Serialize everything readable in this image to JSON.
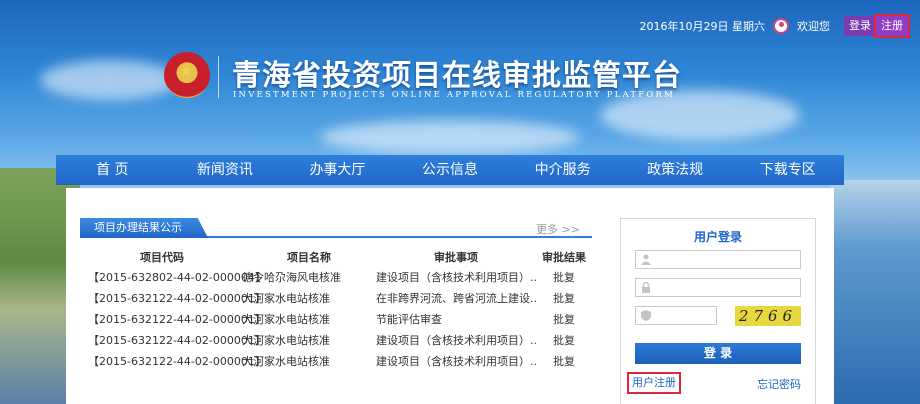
{
  "topbar": {
    "date": "2016年10月29日 星期六",
    "welcome": "欢迎您",
    "login_btn": "登录",
    "register_btn": "注册"
  },
  "header": {
    "title": "青海省投资项目在线审批监管平台",
    "subtitle": "INVESTMENT PROJECTS ONLINE APPROVAL REGULATORY PLATFORM"
  },
  "nav": {
    "items": [
      "首 页",
      "新闻资讯",
      "办事大厅",
      "公示信息",
      "中介服务",
      "政策法规",
      "下载专区"
    ]
  },
  "results": {
    "tab_label": "项目办理结果公示",
    "more": "更多 >>",
    "columns": [
      "项目代码",
      "项目名称",
      "审批事项",
      "审批结果"
    ],
    "rows": [
      [
        "【2015-632802-44-02-000004】",
        "德令哈尕海风电核准",
        "建设项目（含核技术利用项目）...",
        "批复"
      ],
      [
        "【2015-632122-44-02-000001】",
        "大河家水电站核准",
        "在非跨界河流、跨省河流上建设...",
        "批复"
      ],
      [
        "【2015-632122-44-02-000001】",
        "大河家水电站核准",
        "节能评估审查",
        "批复"
      ],
      [
        "【2015-632122-44-02-000001】",
        "大河家水电站核准",
        "建设项目（含核技术利用项目）...",
        "批复"
      ],
      [
        "【2015-632122-44-02-000001】",
        "大河家水电站核准",
        "建设项目（含核技术利用项目）...",
        "批复"
      ]
    ]
  },
  "login": {
    "title": "用户登录",
    "username_value": "",
    "password_value": "",
    "captcha_value": "",
    "captcha_code": "2766",
    "submit": "登 录",
    "register_link": "用户注册",
    "forgot_link": "忘记密码"
  },
  "icons": {
    "user": "user-icon",
    "lock": "lock-icon",
    "shield": "shield-icon",
    "avatar": "avatar-icon",
    "emblem": "emblem-icon"
  },
  "colors": {
    "primary": "#1f66c8",
    "highlight_border": "#e0263a",
    "captcha_bg": "#e8d840",
    "auth_btn": "#7a3ab0"
  }
}
